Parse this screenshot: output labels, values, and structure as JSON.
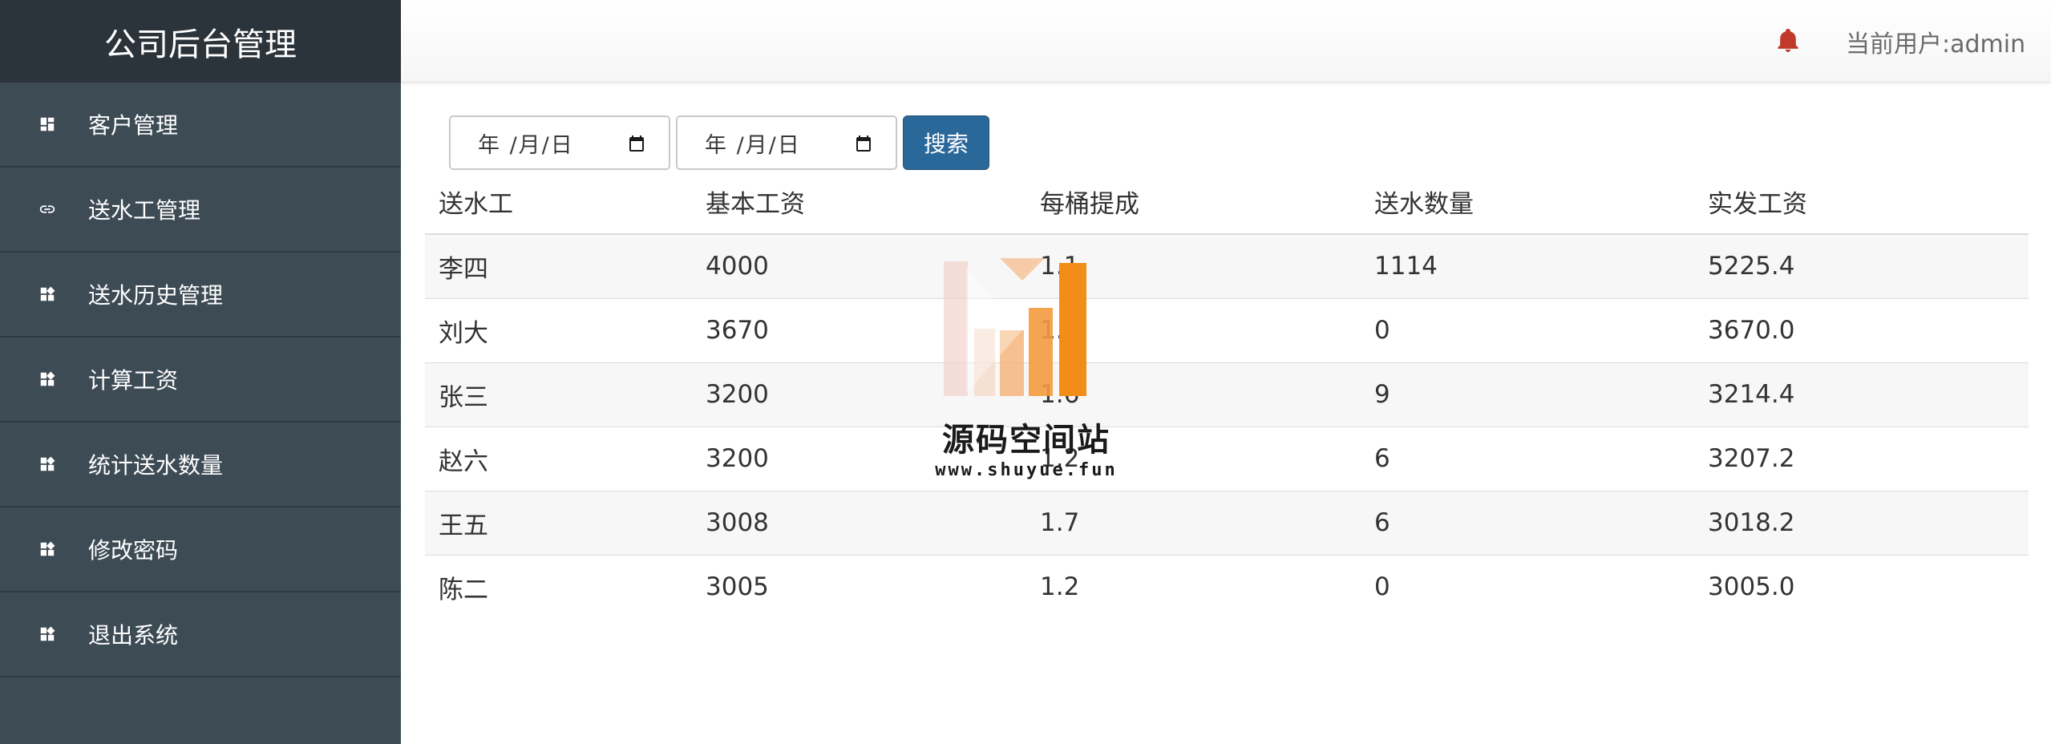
{
  "sidebar": {
    "title": "公司后台管理",
    "items": [
      {
        "label": "客户管理",
        "icon": "dashboard-icon"
      },
      {
        "label": "送水工管理",
        "icon": "link-icon"
      },
      {
        "label": "送水历史管理",
        "icon": "widgets-icon"
      },
      {
        "label": "计算工资",
        "icon": "widgets-icon"
      },
      {
        "label": "统计送水数量",
        "icon": "widgets-icon"
      },
      {
        "label": "修改密码",
        "icon": "widgets-icon"
      },
      {
        "label": "退出系统",
        "icon": "widgets-icon"
      }
    ]
  },
  "header": {
    "user_label": "当前用户:admin",
    "bell_color": "#c0392b"
  },
  "search": {
    "start_date_placeholder": "年 /月/日",
    "end_date_placeholder": "年 /月/日",
    "button_label": "搜索",
    "button_color": "#2b689a"
  },
  "table": {
    "headers": [
      "送水工",
      "基本工资",
      "每桶提成",
      "送水数量",
      "实发工资"
    ],
    "rows": [
      [
        "李四",
        "4000",
        "1.1",
        "1114",
        "5225.4"
      ],
      [
        "刘大",
        "3670",
        "1.0",
        "0",
        "3670.0"
      ],
      [
        "张三",
        "3200",
        "1.6",
        "9",
        "3214.4"
      ],
      [
        "赵六",
        "3200",
        "1.2",
        "6",
        "3207.2"
      ],
      [
        "王五",
        "3008",
        "1.7",
        "6",
        "3018.2"
      ],
      [
        "陈二",
        "3005",
        "1.2",
        "0",
        "3005.0"
      ]
    ]
  },
  "watermark": {
    "title": "源码空间站",
    "url": "www.shuyue.fun"
  }
}
